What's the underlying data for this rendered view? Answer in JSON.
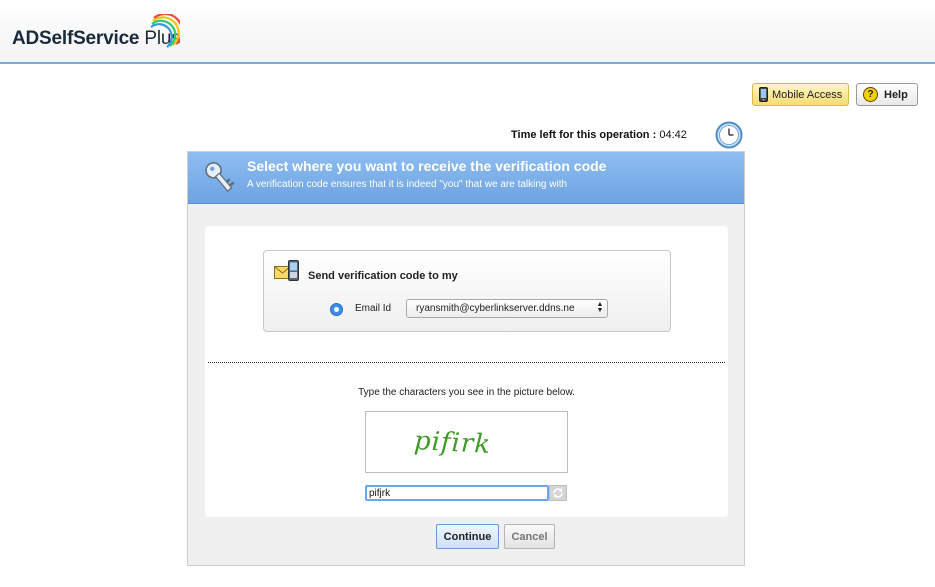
{
  "app": {
    "logo_main": "ADSelfService",
    "logo_plus": " Plus",
    "logo_icon": "rainbow-arc-icon"
  },
  "toolbar": {
    "mobile_access_label": "Mobile Access",
    "mobile_icon": "mobile-phone-icon",
    "help_label": "Help",
    "help_glyph": "?",
    "help_icon": "question-mark-icon"
  },
  "timer": {
    "label": "Time left for this operation :",
    "value": "04:42",
    "icon": "clock-icon"
  },
  "banner": {
    "title": "Select where you want to receive the verification code",
    "subtitle": "A verification code ensures that it is indeed \"you\" that we are talking with",
    "icon": "key-icon"
  },
  "send": {
    "title": "Send verification code to my",
    "icon": "email-sms-icon",
    "option_label": "Email Id",
    "option_selected": true,
    "email_value": "ryansmith@cyberlinkserver.ddns.ne"
  },
  "captcha": {
    "prompt": "Type the characters you see in the picture below.",
    "image_text": "pifirk",
    "input_value": "pifjrk",
    "refresh_icon": "refresh-icon"
  },
  "actions": {
    "continue_label": "Continue",
    "cancel_label": "Cancel"
  },
  "colors": {
    "banner_blue": "#7fb1ea",
    "captcha_green": "#3f9a2a",
    "mobile_button_yellow": "#f6dc70"
  }
}
